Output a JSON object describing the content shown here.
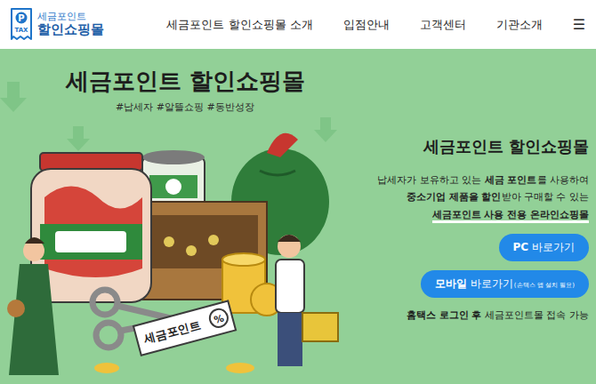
{
  "logo": {
    "icon_letter": "P",
    "icon_text": "TAX",
    "top": "세금포인트",
    "bottom": "할인쇼핑몰"
  },
  "nav": {
    "items": [
      "세금포인트 할인쇼핑몰 소개",
      "입점안내",
      "고객센터",
      "기관소개"
    ],
    "menu_icon": "☰"
  },
  "hero": {
    "title": "세금포인트 할인쇼핑몰",
    "hashtags": "#납세자 #알뜰쇼핑 #동반성장",
    "illustration": {
      "coupon_text": "세금포인트",
      "coupon_badge": "%"
    }
  },
  "intro": {
    "title": "세금포인트 할인쇼핑몰",
    "lines": [
      [
        {
          "text": "납세자가 보유하고 있는 ",
          "bold": false,
          "highlight": false
        },
        {
          "text": "세금 포인트",
          "bold": true,
          "highlight": false
        },
        {
          "text": "를 사용하여",
          "bold": false,
          "highlight": false
        }
      ],
      [
        {
          "text": "중소기업 제품을 할인",
          "bold": true,
          "highlight": false
        },
        {
          "text": "받아 구매할 수 있는",
          "bold": false,
          "highlight": false
        }
      ],
      [
        {
          "text": "세금포인트 사용 전용 온라인쇼핑몰",
          "bold": true,
          "highlight": true
        }
      ]
    ],
    "buttons": [
      {
        "segments": [
          {
            "text": "PC",
            "bold": true
          },
          {
            "text": " 바로가기",
            "bold": false
          }
        ]
      },
      {
        "segments": [
          {
            "text": "모바일",
            "bold": true
          },
          {
            "text": " 바로가기",
            "bold": false
          }
        ],
        "note": "(손택스 앱 설치 필요)"
      }
    ],
    "login_note": [
      {
        "text": "홈택스 로그인 후",
        "bold": true
      },
      {
        "text": " 세금포인트몰 접속 가능",
        "bold": false
      }
    ]
  }
}
